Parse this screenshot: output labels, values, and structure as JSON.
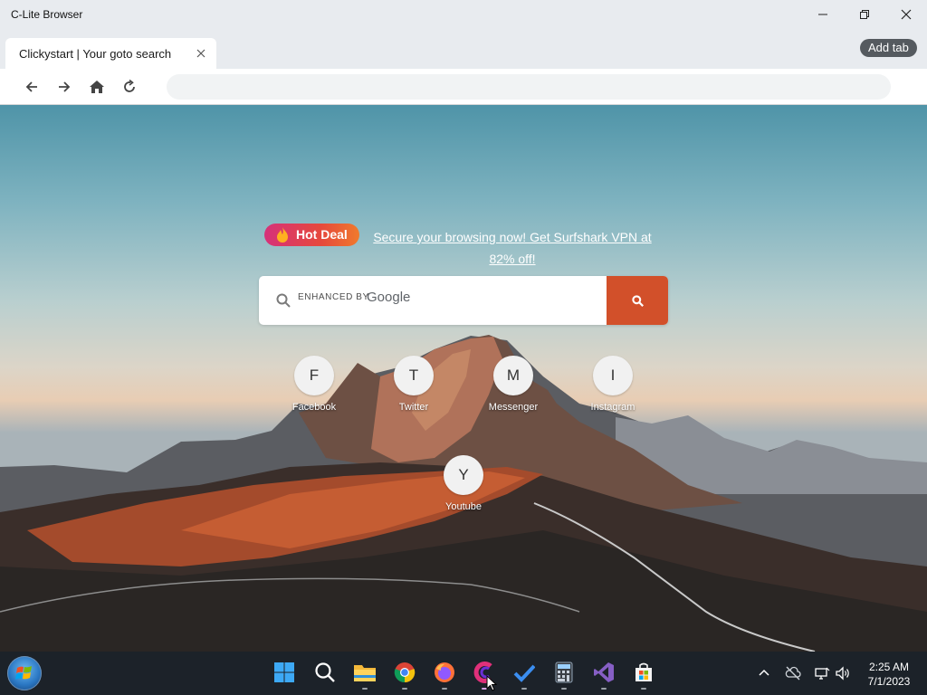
{
  "window": {
    "title": "C-Lite Browser"
  },
  "tabs": [
    {
      "label": "Clickystart | Your goto search"
    }
  ],
  "toolbar": {
    "add_tab_label": "Add tab",
    "address_value": ""
  },
  "promo": {
    "badge": "Hot Deal",
    "link_text": "Secure your browsing now! Get Surfshark VPN at 82% off!"
  },
  "search": {
    "enhanced_label": "ENHANCED BY",
    "provider": "Google",
    "value": ""
  },
  "shortcuts": [
    {
      "letter": "F",
      "label": "Facebook"
    },
    {
      "letter": "T",
      "label": "Twitter"
    },
    {
      "letter": "M",
      "label": "Messenger"
    },
    {
      "letter": "I",
      "label": "Instagram"
    },
    {
      "letter": "Y",
      "label": "Youtube"
    }
  ],
  "taskbar": {
    "apps": [
      "windows-start-icon",
      "search-icon",
      "file-explorer-icon",
      "chrome-icon",
      "firefox-icon",
      "c-lite-browser-icon",
      "todo-icon",
      "calculator-icon",
      "visual-studio-icon",
      "microsoft-store-icon"
    ],
    "time": "2:25 AM",
    "date": "7/1/2023"
  },
  "colors": {
    "accent": "#d2502a",
    "taskbar": "#1c2229",
    "badge_start": "#d6317a",
    "badge_end": "#f07a2c"
  }
}
